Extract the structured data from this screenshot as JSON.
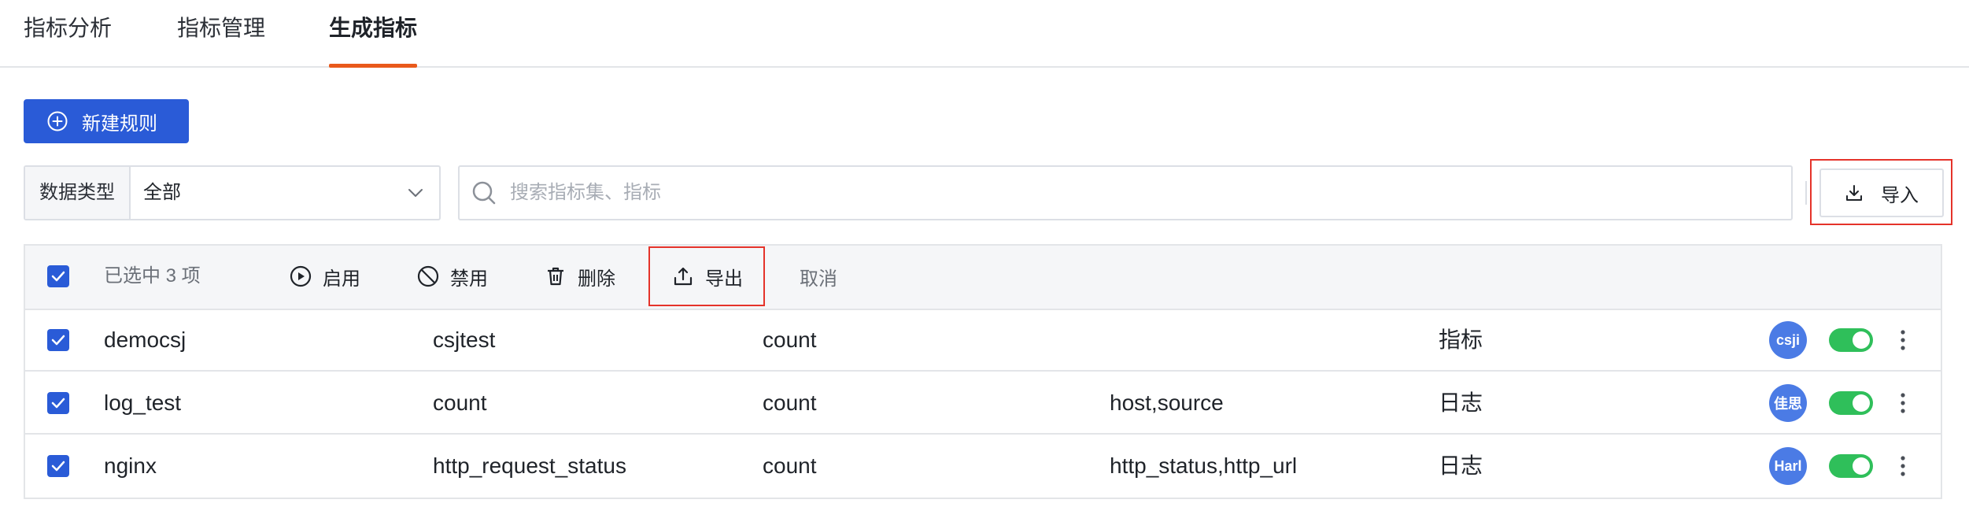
{
  "tabs": [
    {
      "label": "指标分析"
    },
    {
      "label": "指标管理"
    },
    {
      "label": "生成指标",
      "active": true
    }
  ],
  "new_rule_label": "新建规则",
  "filter": {
    "label": "数据类型",
    "value": "全部"
  },
  "search": {
    "placeholder": "搜索指标集、指标"
  },
  "import_label": "导入",
  "toolbar": {
    "selected_text": "已选中 3 项",
    "enable": "启用",
    "disable": "禁用",
    "delete": "删除",
    "export": "导出",
    "cancel": "取消"
  },
  "rows": [
    {
      "name": "democsj",
      "measurement": "csjtest",
      "method": "count",
      "group_by": "",
      "type": "指标",
      "avatar": "csji",
      "enabled": true,
      "checked": true
    },
    {
      "name": "log_test",
      "measurement": "count",
      "method": "count",
      "group_by": "host,source",
      "type": "日志",
      "avatar": "佳思",
      "enabled": true,
      "checked": true
    },
    {
      "name": "nginx",
      "measurement": "http_request_status",
      "method": "count",
      "group_by": "http_status,http_url",
      "type": "日志",
      "avatar": "Harl",
      "enabled": true,
      "checked": true
    }
  ],
  "colors": {
    "primary": "#2a5bd7",
    "tab_active_underline": "#e9591b",
    "highlight": "#e5332a",
    "toggle_on": "#2fbf5a",
    "avatar": "#4b7be5"
  }
}
